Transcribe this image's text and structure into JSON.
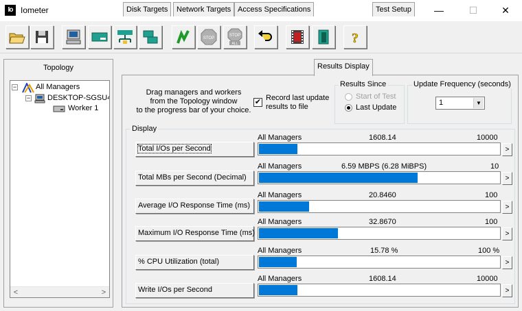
{
  "window": {
    "title": "Iometer",
    "app_icon_text": "Io",
    "min_glyph": "—",
    "max_glyph": "☐",
    "close_glyph": "✕"
  },
  "toolbar": {
    "buttons": [
      {
        "name": "open-config-button",
        "icon": "folder-open-icon"
      },
      {
        "name": "save-config-button",
        "icon": "floppy-disk-icon"
      },
      {
        "name": "start-disk-worker-button",
        "icon": "computer-icon"
      },
      {
        "name": "start-network-worker-button",
        "icon": "disk-worker-icon"
      },
      {
        "name": "network-worker-button",
        "icon": "network-icon"
      },
      {
        "name": "duplicate-worker-button",
        "icon": "duplicate-icon"
      },
      {
        "name": "start-tests-button",
        "icon": "green-flag-icon",
        "color": "#2db83d"
      },
      {
        "name": "stop-button",
        "icon": "stop-sign-icon",
        "label": "STOP"
      },
      {
        "name": "stop-all-button",
        "icon": "stop-all-icon",
        "label": "STOP",
        "label2": "ALL"
      },
      {
        "name": "reset-workers-button",
        "icon": "reset-arrow-icon"
      },
      {
        "name": "exit-button",
        "icon": "film-strip-icon"
      },
      {
        "name": "exit-door-button",
        "icon": "exit-door-icon"
      },
      {
        "name": "help-button",
        "icon": "help-question-icon",
        "label": "?"
      }
    ]
  },
  "topology": {
    "header": "Topology",
    "items": [
      {
        "label": "All Managers",
        "toggle": "−"
      },
      {
        "label": "DESKTOP-SGSU4",
        "toggle": "−"
      },
      {
        "label": "Worker 1"
      }
    ],
    "scroll_left": "<",
    "scroll_right": ">"
  },
  "tabs": [
    {
      "label": "Disk Targets",
      "active": false
    },
    {
      "label": "Network Targets",
      "active": false
    },
    {
      "label": "Access Specifications",
      "active": false
    },
    {
      "label": "Results Display",
      "active": true
    },
    {
      "label": "Test Setup",
      "active": false
    }
  ],
  "results": {
    "instructions_line1": "Drag managers and workers",
    "instructions_line2": "from the Topology window",
    "instructions_line3": "to the progress bar of your choice.",
    "record_checkbox_label_line1": "Record last update",
    "record_checkbox_label_line2": "results to file",
    "record_checked": true,
    "results_since": {
      "title": "Results Since",
      "option1": "Start of Test",
      "option2": "Last Update",
      "selected": "Last Update"
    },
    "update_frequency": {
      "title": "Update Frequency (seconds)",
      "value": "1"
    },
    "display_title": "Display",
    "bar_color": "#0078d7",
    "rows": [
      {
        "button": "Total I/Os per Second",
        "source": "All Managers",
        "value": "1608.14",
        "max": "10000",
        "fill": 0.16
      },
      {
        "button": "Total MBs per Second (Decimal)",
        "source": "All Managers",
        "value": "6.59 MBPS (6.28 MiBPS)",
        "max": "10",
        "fill": 0.659
      },
      {
        "button": "Average I/O Response Time (ms)",
        "source": "All Managers",
        "value": "20.8460",
        "max": "100",
        "fill": 0.208
      },
      {
        "button": "Maximum I/O Response Time (ms)",
        "source": "All Managers",
        "value": "32.8670",
        "max": "100",
        "fill": 0.329
      },
      {
        "button": "% CPU Utilization (total)",
        "source": "All Managers",
        "value": "15.78 %",
        "max": "100 %",
        "fill": 0.158
      },
      {
        "button": "Write I/Os per Second",
        "source": "All Managers",
        "value": "1608.14",
        "max": "10000",
        "fill": 0.16
      }
    ],
    "row_arrow": ">"
  }
}
